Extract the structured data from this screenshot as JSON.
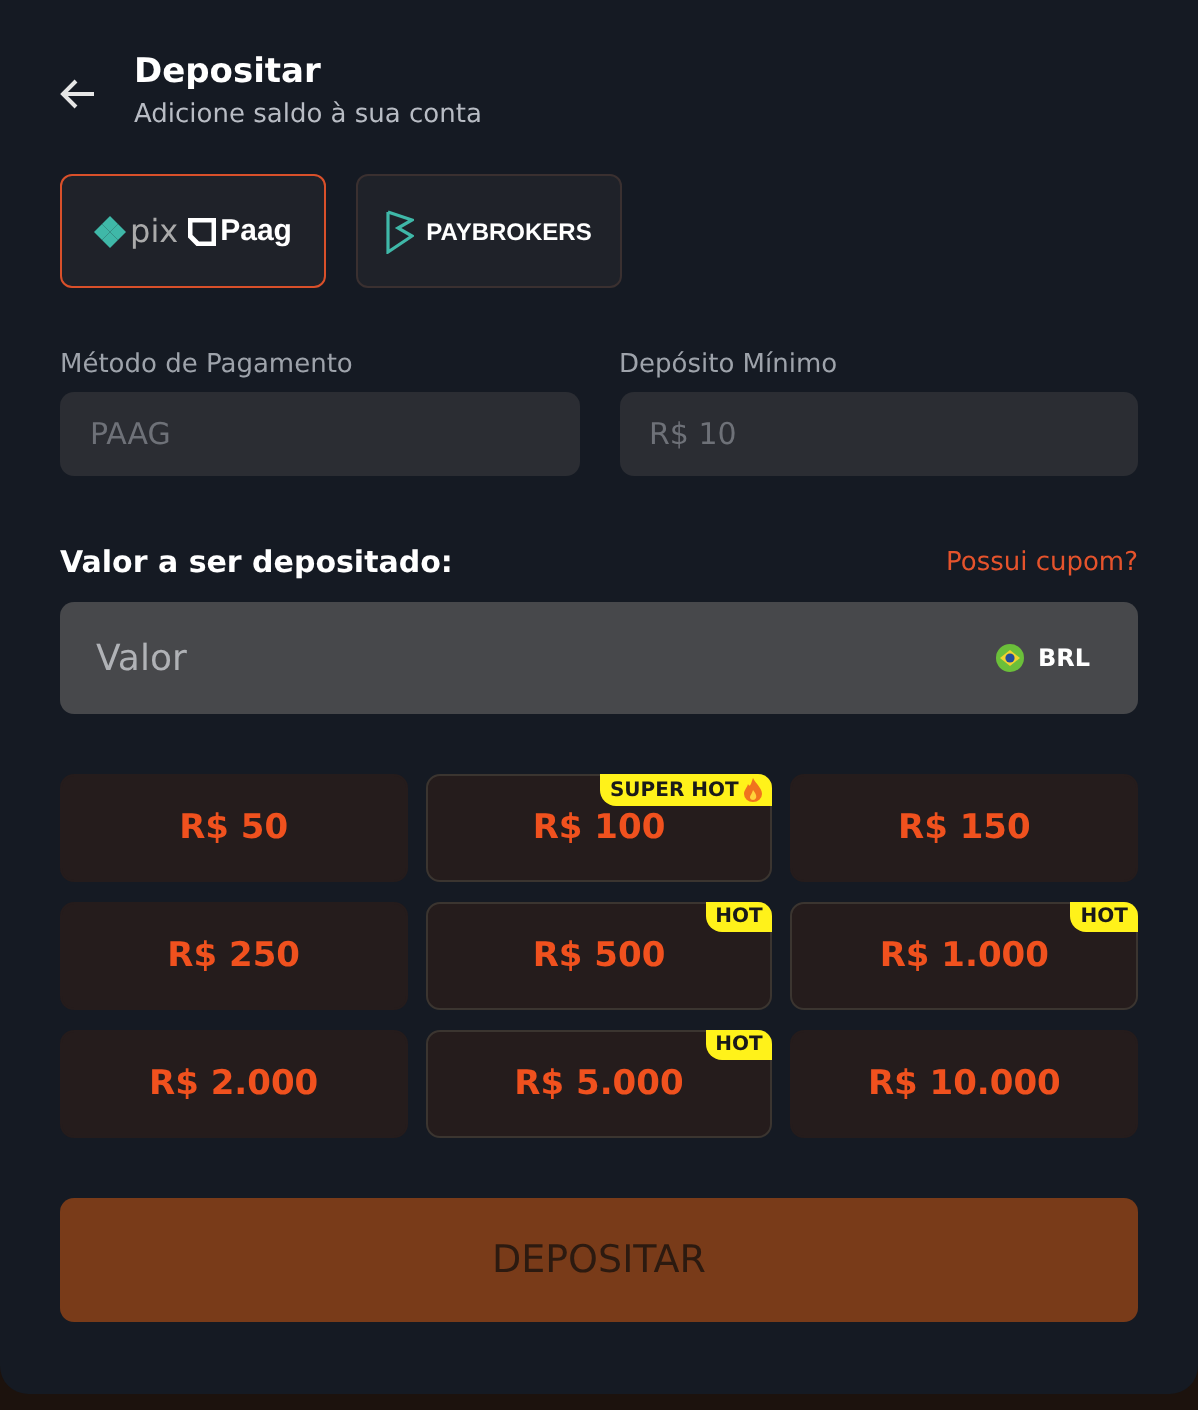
{
  "header": {
    "title": "Depositar",
    "subtitle": "Adicione saldo à sua conta"
  },
  "providers": [
    {
      "kind": "pix-paag",
      "texts": [
        "pix",
        "Paag"
      ],
      "selected": true
    },
    {
      "kind": "paybrokers",
      "texts": [
        "PAYBROKERS"
      ],
      "selected": false
    }
  ],
  "info_fields": [
    {
      "label": "Método de Pagamento",
      "value": "PAAG"
    },
    {
      "label": "Depósito Mínimo",
      "value": "R$ 10"
    }
  ],
  "amount": {
    "label": "Valor a ser depositado:",
    "coupon_link": "Possui cupom?",
    "placeholder": "Valor",
    "currency": "BRL"
  },
  "presets": [
    {
      "amount": "R$ 50"
    },
    {
      "amount": "R$ 100",
      "badge": "SUPER HOT",
      "flame": true
    },
    {
      "amount": "R$ 150"
    },
    {
      "amount": "R$ 250"
    },
    {
      "amount": "R$ 500",
      "badge": "HOT",
      "flame": false
    },
    {
      "amount": "R$ 1.000",
      "badge": "HOT",
      "flame": false
    },
    {
      "amount": "R$ 2.000"
    },
    {
      "amount": "R$ 5.000",
      "badge": "HOT",
      "flame": false
    },
    {
      "amount": "R$ 10.000"
    }
  ],
  "submit": {
    "label": "DEPOSITAR",
    "disabled": true
  }
}
